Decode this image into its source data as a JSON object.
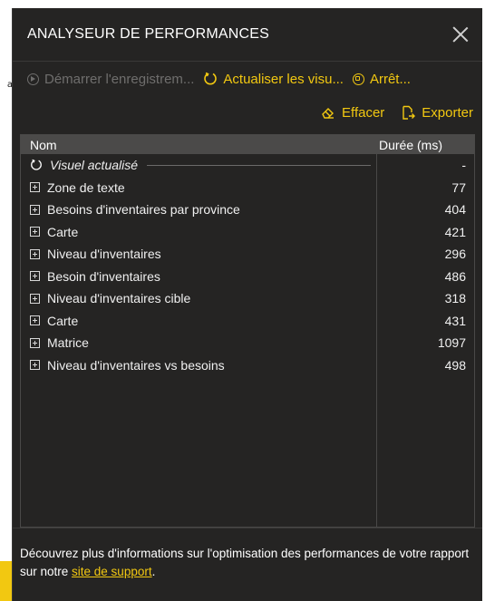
{
  "background": {
    "left_mark": "a"
  },
  "panel": {
    "title": "ANALYSEUR DE PERFORMANCES",
    "toolbar": {
      "start": "Démarrer l'enregistrem...",
      "refresh": "Actualiser les visu...",
      "stop": "Arrêt..."
    },
    "actions": {
      "clear": "Effacer",
      "export": "Exporter"
    },
    "table": {
      "columns": [
        "Nom",
        "Durée (ms)"
      ],
      "refreshed_row": {
        "label": "Visuel actualisé",
        "value": "-"
      },
      "rows": [
        {
          "name": "Zone de texte",
          "duration": "77"
        },
        {
          "name": "Besoins d'inventaires par province",
          "duration": "404"
        },
        {
          "name": "Carte",
          "duration": "421"
        },
        {
          "name": "Niveau d'inventaires",
          "duration": "296"
        },
        {
          "name": "Besoin d'inventaires",
          "duration": "486"
        },
        {
          "name": "Niveau d'inventaires cible",
          "duration": "318"
        },
        {
          "name": "Carte",
          "duration": "431"
        },
        {
          "name": "Matrice",
          "duration": "1097"
        },
        {
          "name": "Niveau d'inventaires vs besoins",
          "duration": "498"
        }
      ]
    },
    "footer": {
      "text": "Découvrez plus d'informations sur l'optimisation des performances de votre rapport sur notre ",
      "link": "site de support",
      "suffix": "."
    }
  },
  "colors": {
    "panel_bg": "#252423",
    "accent": "#f2c811",
    "disabled": "#6f6e6d",
    "header_row": "#4b4a49"
  },
  "icons": {
    "start": "play-circle-icon",
    "refresh": "refresh-icon",
    "stop": "stop-circle-icon",
    "clear": "eraser-icon",
    "export": "export-icon",
    "close": "close-icon",
    "expand": "expand-plus-icon"
  }
}
